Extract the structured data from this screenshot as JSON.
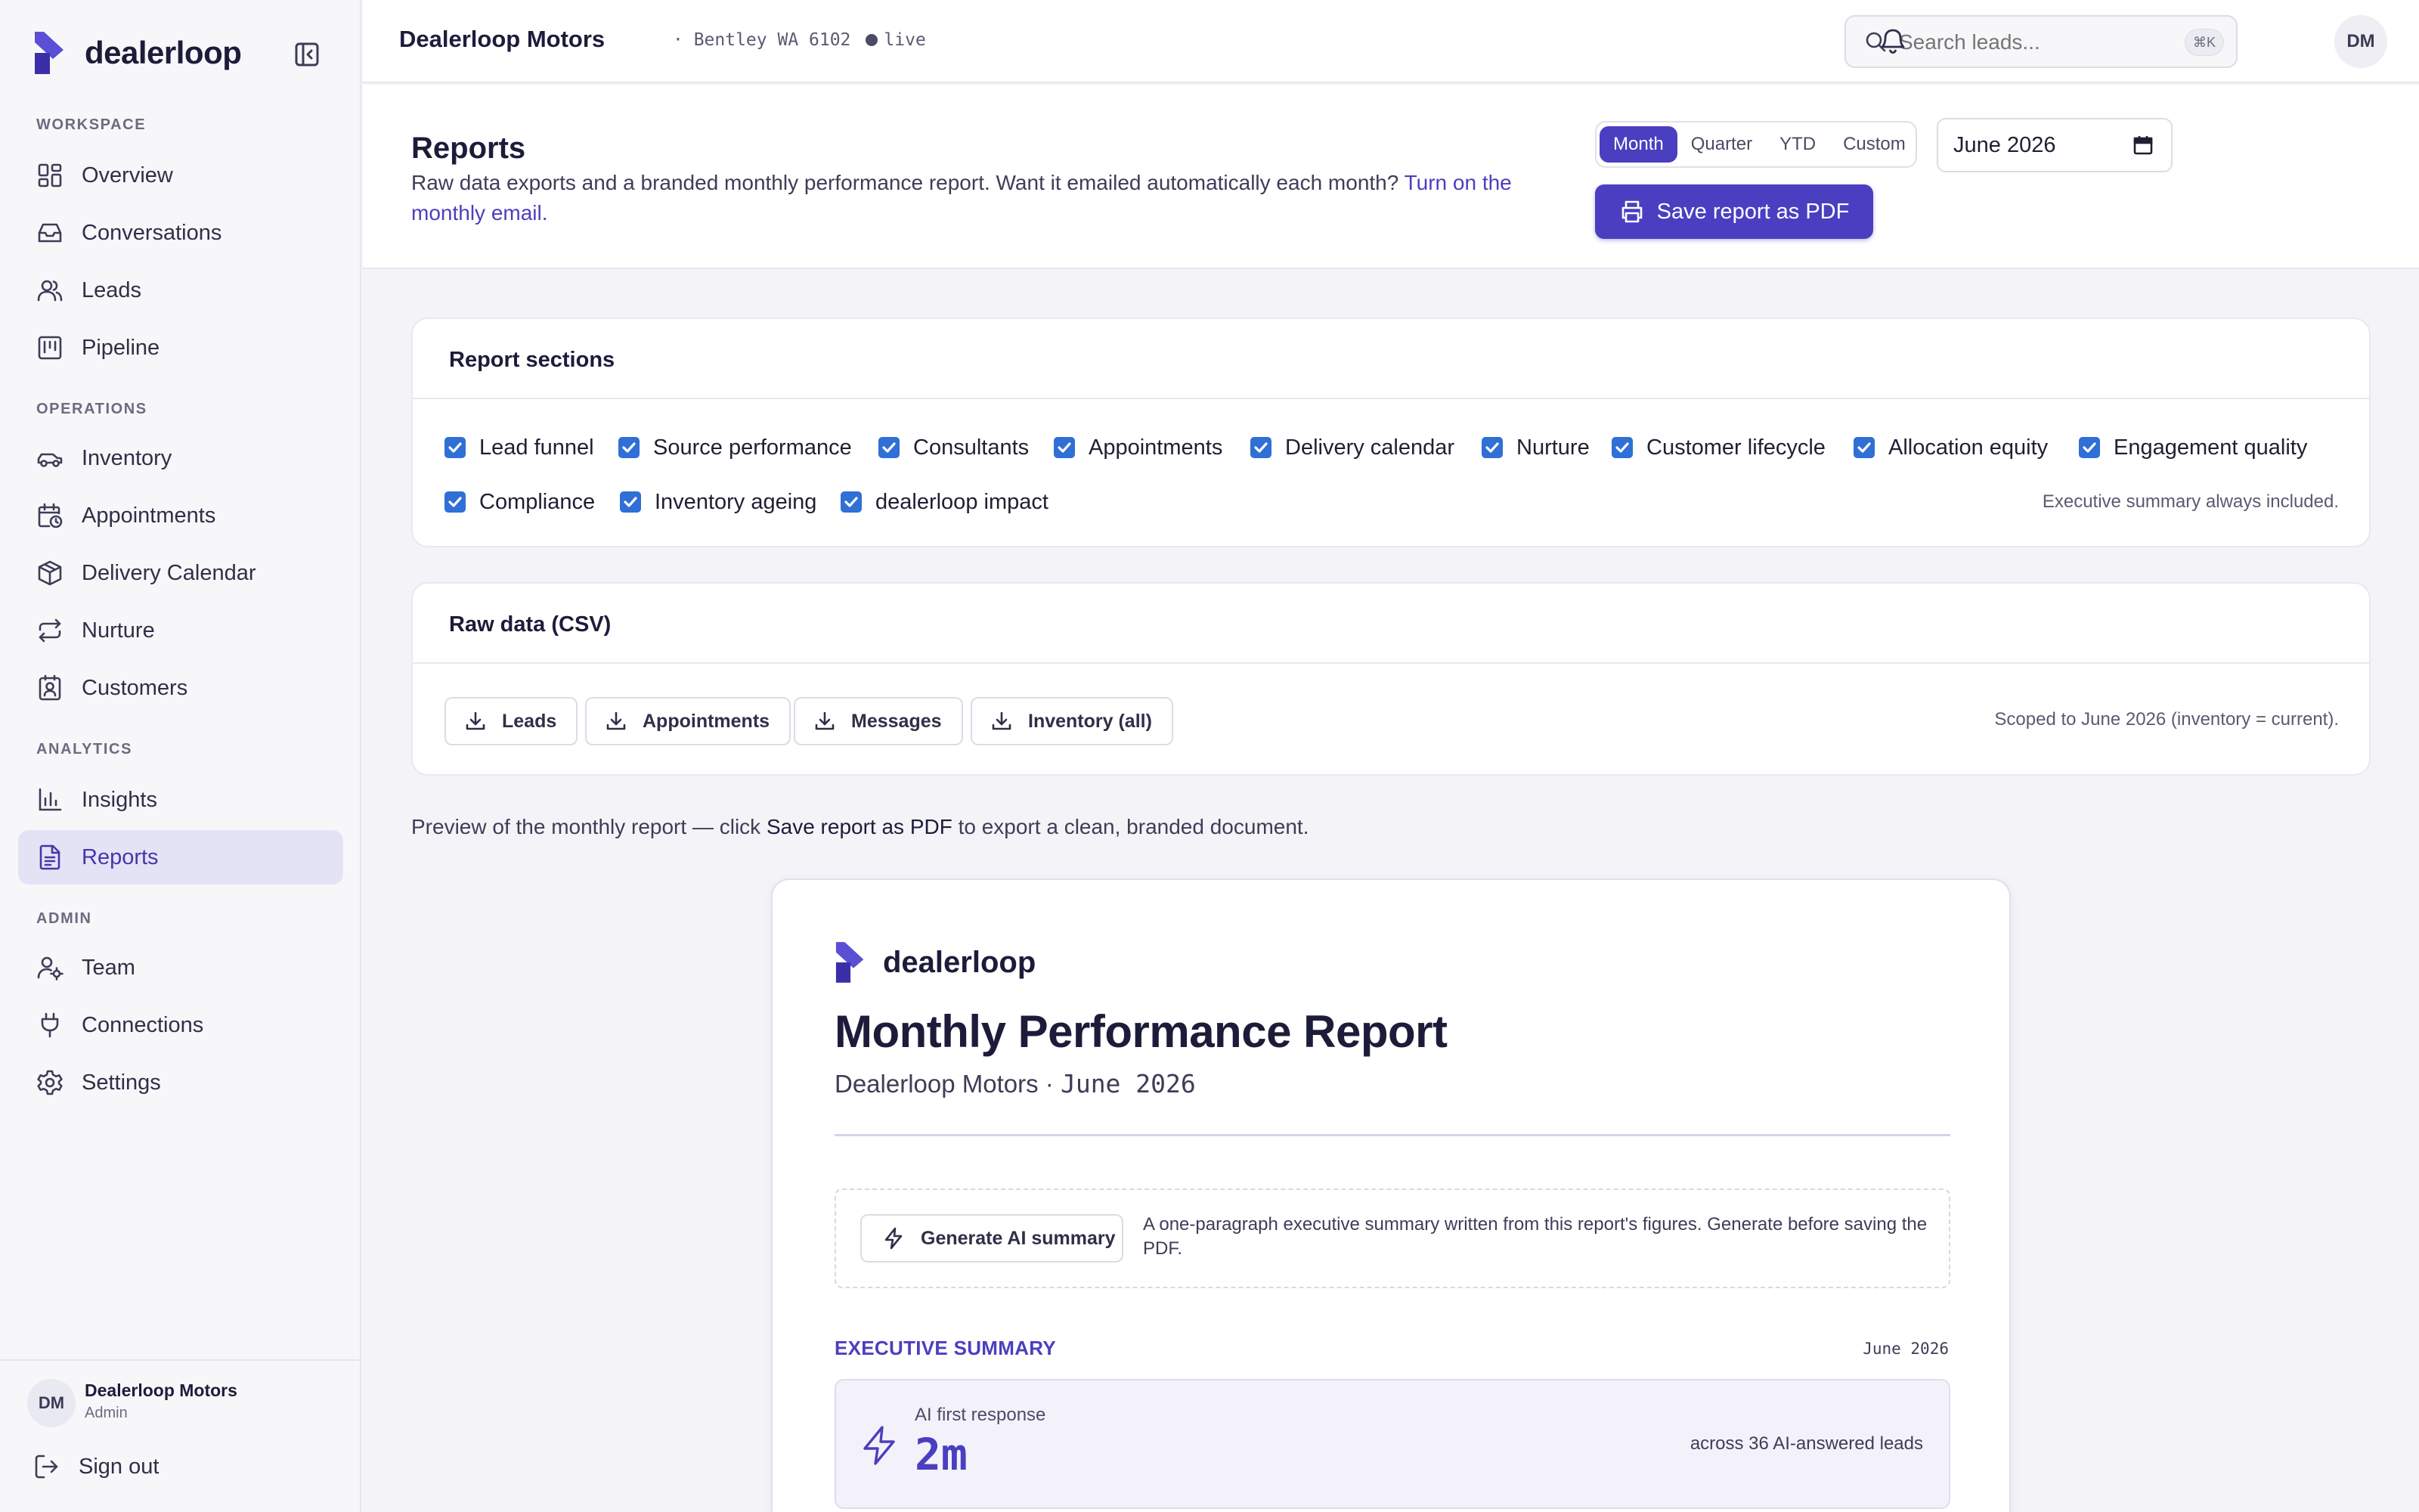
{
  "colors": {
    "accent": "#4a3fc0",
    "checkbox": "#2f6fd6",
    "sidebar_bg": "#f7f7fa",
    "active_nav_bg": "#e4e3f6"
  },
  "sidebar": {
    "brand": "dealerloop",
    "sections": {
      "workspace": "WORKSPACE",
      "operations": "OPERATIONS",
      "analytics": "ANALYTICS",
      "admin": "ADMIN"
    },
    "items": [
      {
        "label": "Overview",
        "icon": "dashboard-icon"
      },
      {
        "label": "Conversations",
        "icon": "inbox-icon"
      },
      {
        "label": "Leads",
        "icon": "users-icon"
      },
      {
        "label": "Pipeline",
        "icon": "kanban-icon"
      },
      {
        "label": "Inventory",
        "icon": "car-icon"
      },
      {
        "label": "Appointments",
        "icon": "calendar-clock-icon"
      },
      {
        "label": "Delivery Calendar",
        "icon": "package-icon"
      },
      {
        "label": "Nurture",
        "icon": "repeat-icon"
      },
      {
        "label": "Customers",
        "icon": "contact-icon"
      },
      {
        "label": "Insights",
        "icon": "bar-chart-icon"
      },
      {
        "label": "Reports",
        "icon": "file-text-icon",
        "active": true
      },
      {
        "label": "Team",
        "icon": "user-cog-icon"
      },
      {
        "label": "Connections",
        "icon": "plug-icon"
      },
      {
        "label": "Settings",
        "icon": "gear-icon"
      }
    ],
    "user": {
      "initials": "DM",
      "name": "Dealerloop Motors",
      "role": "Admin"
    },
    "signout": "Sign out"
  },
  "topbar": {
    "title": "Dealerloop Motors",
    "location": "· Bentley WA 6102",
    "status": "live",
    "search_placeholder": "Search leads...",
    "shortcut": "⌘K",
    "avatar": "DM"
  },
  "header": {
    "title": "Reports",
    "description": "Raw data exports and a branded monthly performance report. Want it emailed automatically each month? ",
    "link": "Turn on the monthly email.",
    "periods": [
      "Month",
      "Quarter",
      "YTD",
      "Custom"
    ],
    "active_period": "Month",
    "date_value": "June 2026",
    "pdf_button": "Save report as PDF"
  },
  "sections_card": {
    "title": "Report sections",
    "options": [
      "Lead funnel",
      "Source performance",
      "Consultants",
      "Appointments",
      "Delivery calendar",
      "Nurture",
      "Customer lifecycle",
      "Allocation equity",
      "Engagement quality",
      "Compliance",
      "Inventory ageing",
      "dealerloop impact"
    ],
    "note": "Executive summary always included."
  },
  "csv_card": {
    "title": "Raw data (CSV)",
    "buttons": [
      "Leads",
      "Appointments",
      "Messages",
      "Inventory (all)"
    ],
    "note": "Scoped to June 2026 (inventory = current)."
  },
  "preview": {
    "pre": "Preview of the monthly report — click ",
    "emph": "Save report as PDF",
    "post": " to export a clean, branded document."
  },
  "report": {
    "brand": "dealerloop",
    "title": "Monthly Performance Report",
    "dealer": "Dealerloop Motors",
    "separator": " · ",
    "period": "June 2026",
    "ai_button": "Generate AI summary",
    "ai_description": "A one-paragraph executive summary written from this report's figures. Generate before saving the PDF.",
    "exec_label": "EXECUTIVE SUMMARY",
    "exec_period": "June 2026",
    "kpi": {
      "label": "AI first response",
      "value": "2m",
      "note_pre": "across ",
      "note_count": "36",
      "note_post": " AI-answered leads"
    }
  }
}
